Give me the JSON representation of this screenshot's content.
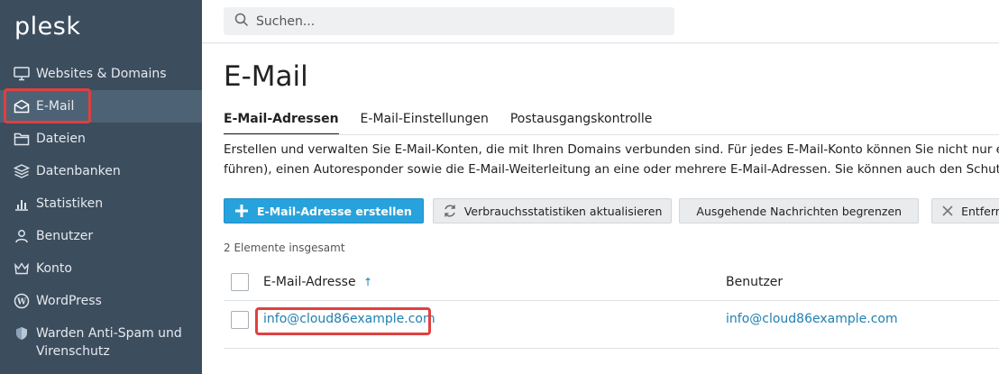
{
  "app": {
    "logo": "plesk"
  },
  "sidebar": {
    "items": [
      {
        "label": "Websites & Domains",
        "icon": "monitor-icon"
      },
      {
        "label": "E-Mail",
        "icon": "mail-icon",
        "active": true
      },
      {
        "label": "Dateien",
        "icon": "folder-icon"
      },
      {
        "label": "Datenbanken",
        "icon": "database-icon"
      },
      {
        "label": "Statistiken",
        "icon": "bar-chart-icon"
      },
      {
        "label": "Benutzer",
        "icon": "user-icon"
      },
      {
        "label": "Konto",
        "icon": "crown-icon"
      },
      {
        "label": "WordPress",
        "icon": "wordpress-icon"
      },
      {
        "label": "Warden Anti-Spam und Virenschutz",
        "icon": "shield-icon"
      }
    ]
  },
  "search": {
    "placeholder": "Suchen..."
  },
  "page": {
    "title": "E-Mail",
    "tabs": [
      {
        "label": "E-Mail-Adressen",
        "active": true
      },
      {
        "label": "E-Mail-Einstellungen"
      },
      {
        "label": "Postausgangskontrolle"
      }
    ],
    "description_line1": "Erstellen und verwalten Sie E-Mail-Konten, die mit Ihren Domains verbunden sind. Für jedes E-Mail-Konto können Sie nicht nur ein Po",
    "description_line2": "führen), einen Autoresponder sowie die E-Mail-Weiterleitung an eine oder mehrere E-Mail-Adressen. Sie können auch den Schutz vo"
  },
  "toolbar": {
    "create": "E-Mail-Adresse erstellen",
    "refresh": "Verbrauchsstatistiken aktualisieren",
    "limit": "Ausgehende Nachrichten begrenzen",
    "remove": "Entfernen"
  },
  "table": {
    "count": "2 Elemente insgesamt",
    "columns": {
      "address": "E-Mail-Adresse",
      "sort_indicator": "↑",
      "user": "Benutzer"
    },
    "rows": [
      {
        "address": "info@cloud86example.com",
        "user": "info@cloud86example.com"
      }
    ]
  },
  "colors": {
    "sidebar": "#3c4d5e",
    "accent": "#28a2dc",
    "link": "#1f7fb0",
    "highlight": "#e04040"
  }
}
